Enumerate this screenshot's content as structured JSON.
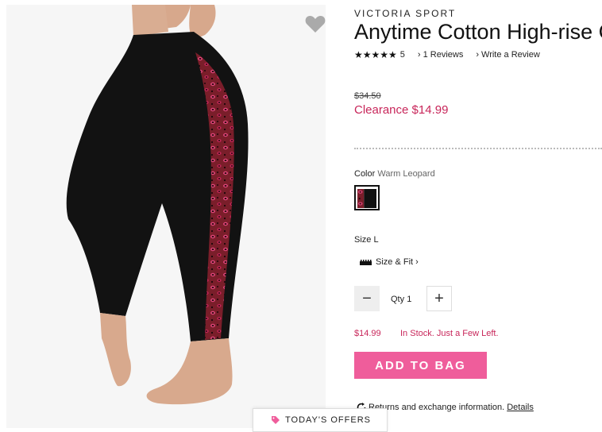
{
  "product": {
    "brand": "VICTORIA SPORT",
    "title": "Anytime Cotton High-rise C",
    "stars": "★★★★★",
    "rating_count": "5",
    "reviews_link": "1 Reviews",
    "write_review_link": "Write a Review"
  },
  "pricing": {
    "original": "$34.50",
    "clearance": "Clearance $14.99",
    "accent_color": "#c8265a"
  },
  "color": {
    "label": "Color",
    "value": "Warm Leopard"
  },
  "size": {
    "label": "Size L",
    "fit_link": "Size & Fit"
  },
  "quantity": {
    "label": "Qty",
    "value": "1"
  },
  "availability": {
    "price": "$14.99",
    "stock": "In Stock. Just a Few Left."
  },
  "actions": {
    "add_to_bag": "ADD TO BAG",
    "button_color": "#ef5d9b"
  },
  "returns": {
    "text": "Returns and exchange information.",
    "details": "Details"
  },
  "offers": {
    "label": "TODAY'S OFFERS"
  },
  "icons": [
    "heart-icon",
    "chevron-right-icon",
    "ruler-icon",
    "minus-icon",
    "plus-icon",
    "refresh-icon",
    "tag-icon"
  ]
}
